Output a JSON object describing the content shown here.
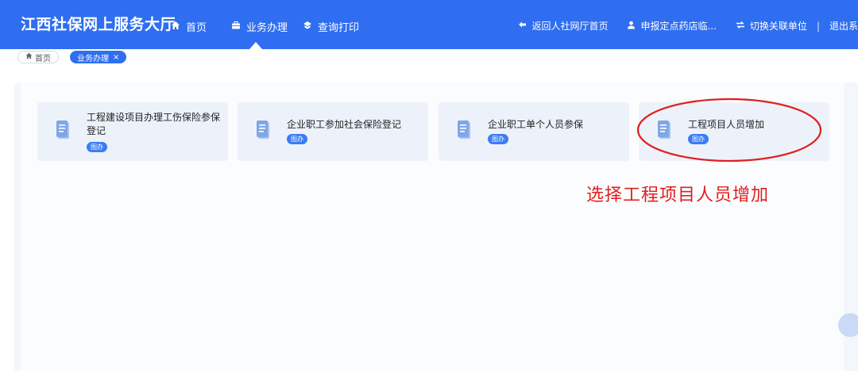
{
  "header": {
    "brand": "江西社保网上服务大厅",
    "nav": [
      {
        "label": "首页",
        "icon": "home-icon"
      },
      {
        "label": "业务办理",
        "icon": "briefcase-icon",
        "active": true
      },
      {
        "label": "查询打印",
        "icon": "print-icon"
      }
    ],
    "links": [
      {
        "label": "返回人社网厅首页",
        "icon": "back-arrow-icon"
      },
      {
        "label": "申报定点药店临...",
        "icon": "user-icon"
      },
      {
        "label": "切换关联单位",
        "icon": "switch-icon"
      },
      {
        "label": "退出系",
        "icon": ""
      }
    ],
    "separator": "|"
  },
  "breadcrumb": {
    "home": "首页",
    "active": "业务办理",
    "close_glyph": "×"
  },
  "cards": [
    {
      "title_line1": "工程建设项目办理工伤保险参保",
      "title_line2": "登记",
      "badge": "图办"
    },
    {
      "title_line1": "企业职工参加社会保险登记",
      "title_line2": "",
      "badge": "图办"
    },
    {
      "title_line1": "企业职工单个人员参保",
      "title_line2": "",
      "badge": "图办"
    },
    {
      "title_line1": "工程项目人员增加",
      "title_line2": "",
      "badge": "图办"
    }
  ],
  "annotation": "选择工程项目人员增加",
  "colors": {
    "header_bg": "#2f6ef0",
    "card_bg": "#edf2fa",
    "badge_bg": "#3b7cf5",
    "annotation": "#e02020"
  }
}
